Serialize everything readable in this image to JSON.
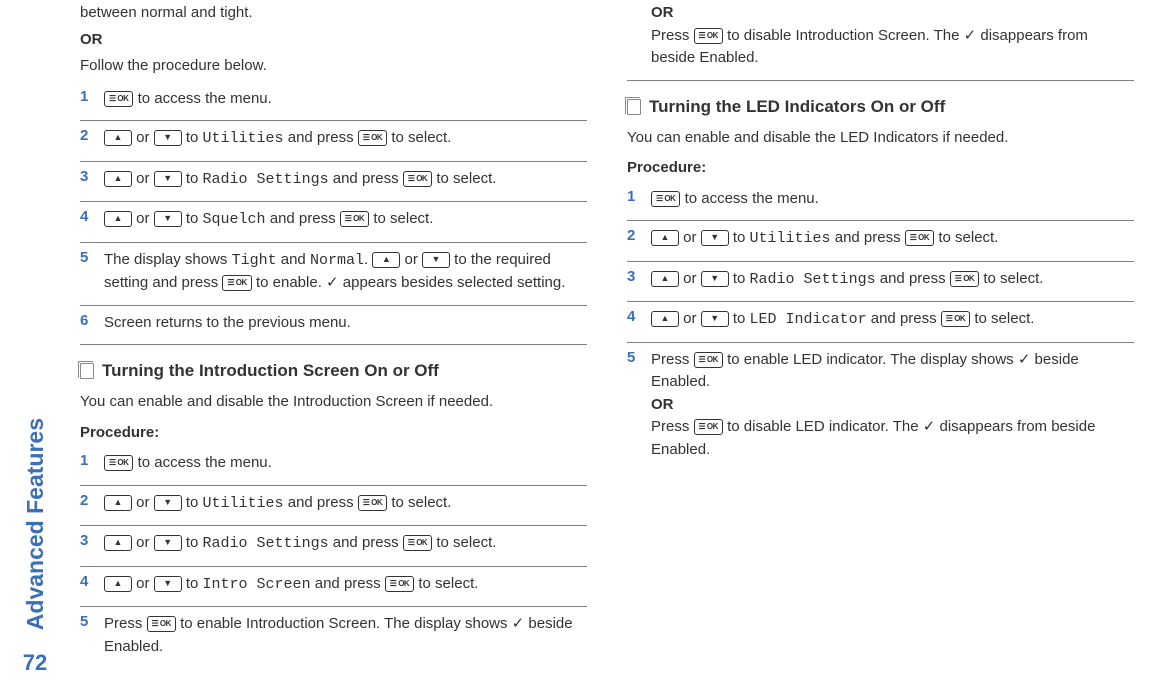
{
  "sidebar": {
    "title": "Advanced Features",
    "page_number": "72"
  },
  "left": {
    "intro_text1": "between normal and tight.",
    "or": "OR",
    "intro_text2": "Follow the procedure below.",
    "squelch_steps": [
      {
        "n": "1",
        "post_ok1": " to access the menu."
      },
      {
        "n": "2",
        "mid": " or ",
        "to": " to ",
        "menu": "Utilities",
        "press": " and press ",
        "sel": " to select."
      },
      {
        "n": "3",
        "mid": " or ",
        "to": " to ",
        "menu": "Radio Settings",
        "press": " and press ",
        "sel": " to select."
      },
      {
        "n": "4",
        "mid": " or ",
        "to": " to ",
        "menu": "Squelch",
        "press": " and press ",
        "sel": " to select."
      },
      {
        "n": "5",
        "pre": "The display shows ",
        "m1": "Tight",
        "and": " and ",
        "m2": "Normal",
        "dot": ". ",
        "mid": " or ",
        "to": " to the required setting and press ",
        "enable": " to enable. ✓ appears besides selected setting."
      },
      {
        "n": "6",
        "text": "Screen returns to the previous menu."
      }
    ],
    "section2_title": "Turning the Introduction Screen On or Off",
    "section2_desc": "You can enable and disable the Introduction Screen if needed.",
    "procedure": "Procedure:",
    "intro_steps": [
      {
        "n": "1",
        "post_ok1": " to access the menu."
      },
      {
        "n": "2",
        "mid": " or ",
        "to": " to ",
        "menu": "Utilities",
        "press": " and press ",
        "sel": " to select."
      },
      {
        "n": "3",
        "mid": " or ",
        "to": " to ",
        "menu": "Radio Settings",
        "press": " and press ",
        "sel": " to select."
      },
      {
        "n": "4",
        "mid": " or ",
        "to": " to ",
        "menu": "Intro Screen",
        "press": " and press ",
        "sel": " to select."
      },
      {
        "n": "5",
        "pre": "Press ",
        "post": " to enable Introduction Screen. The display shows ✓ beside Enabled."
      }
    ]
  },
  "right": {
    "or": "OR",
    "step5b_pre": "Press ",
    "step5b_post": " to disable Introduction Screen. The ✓ disappears from beside Enabled.",
    "section3_title": "Turning the LED Indicators On or Off",
    "section3_desc": "You can enable and disable the LED Indicators if needed.",
    "procedure": "Procedure:",
    "led_steps": [
      {
        "n": "1",
        "post_ok1": " to access the menu."
      },
      {
        "n": "2",
        "mid": " or ",
        "to": " to ",
        "menu": "Utilities",
        "press": " and press ",
        "sel": " to select."
      },
      {
        "n": "3",
        "mid": " or ",
        "to": " to ",
        "menu": "Radio Settings",
        "press": " and press ",
        "sel": " to select."
      },
      {
        "n": "4",
        "mid": " or ",
        "to": " to ",
        "menu": "LED Indicator",
        "press": " and press ",
        "sel": " to select."
      },
      {
        "n": "5",
        "pre": "Press ",
        "post": " to enable LED indicator. The display shows ✓ beside Enabled.",
        "or": "OR",
        "pre2": "Press ",
        "post2": " to disable LED indicator. The ✓ disappears from beside Enabled."
      }
    ]
  }
}
